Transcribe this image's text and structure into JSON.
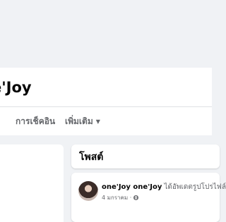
{
  "profile": {
    "name": "e'Joy"
  },
  "tabs": [
    {
      "label": "การเช็คอิน"
    },
    {
      "label": "เพิ่มเติม"
    }
  ],
  "posts_section": {
    "title": "โพสต์"
  },
  "post": {
    "author": "one'Joy one'Joy",
    "action": "ได้อัพเดตรูปโปรไฟล์",
    "date": "4 มกราคม",
    "separator": "·",
    "privacy_icon": "globe-icon"
  },
  "colors": {
    "page_bg": "#f0f2f5",
    "card_bg": "#ffffff",
    "secondary_text": "#65676b"
  }
}
